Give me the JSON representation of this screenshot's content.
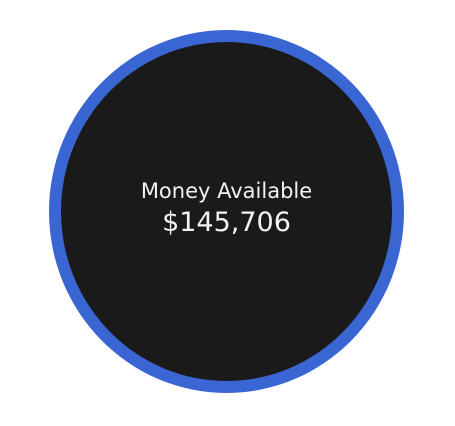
{
  "widget": {
    "label": "Money Available",
    "amount": "$145,706",
    "colors": {
      "ring": "#3a66d4",
      "disc": "#1a1a1a",
      "text": "#f2f2f2",
      "background": "#ffffff"
    }
  }
}
